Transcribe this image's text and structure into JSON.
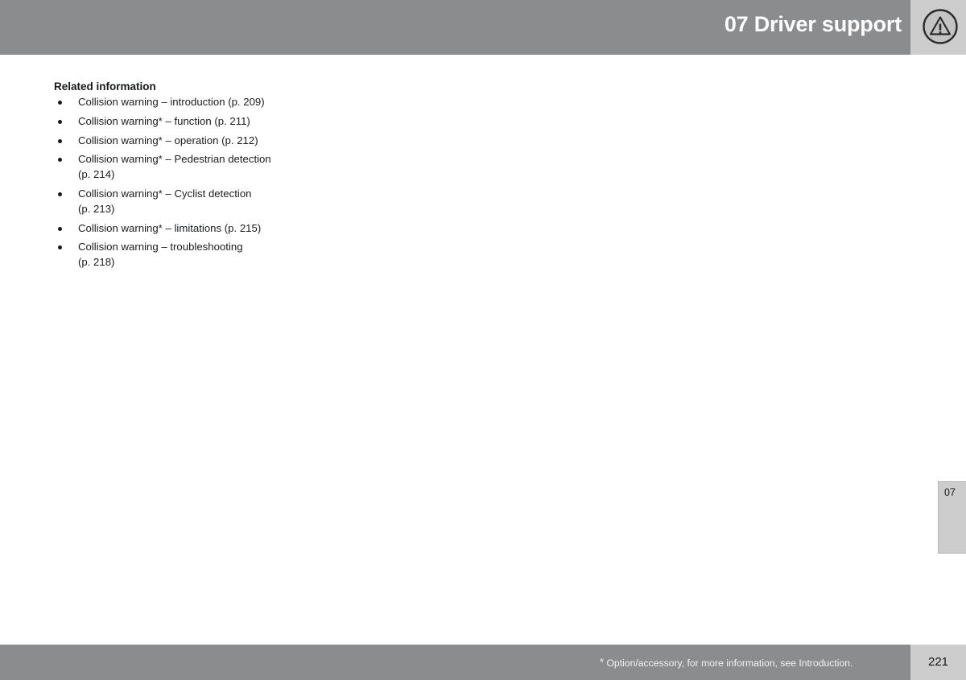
{
  "header": {
    "title": "07 Driver support",
    "icon": "warning-triangle-icon",
    "band_color": "#8a8c8e",
    "panel_color": "#cdcdcd",
    "title_color": "#ffffff"
  },
  "main": {
    "section_heading": "Related information",
    "related_information": [
      {
        "text": "Collision warning – introduction (p. 209)"
      },
      {
        "text": "Collision warning* – function (p. 211)"
      },
      {
        "text": "Collision warning* – operation (p. 212)"
      },
      {
        "text": "Collision warning* – Pedestrian detection\n(p. 214)"
      },
      {
        "text": "Collision warning* – Cyclist detection\n(p. 213)"
      },
      {
        "text": "Collision warning* – limitations (p. 215)"
      },
      {
        "text": "Collision warning – troubleshooting\n(p. 218)"
      }
    ]
  },
  "chapter_tab": {
    "label": "07",
    "color": "#cdcdcd"
  },
  "footer": {
    "asterisk": "*",
    "note": "Option/accessory, for more information, see Introduction.",
    "page_number": "221",
    "band_color": "#8a8c8e",
    "panel_color": "#cdcdcd"
  }
}
